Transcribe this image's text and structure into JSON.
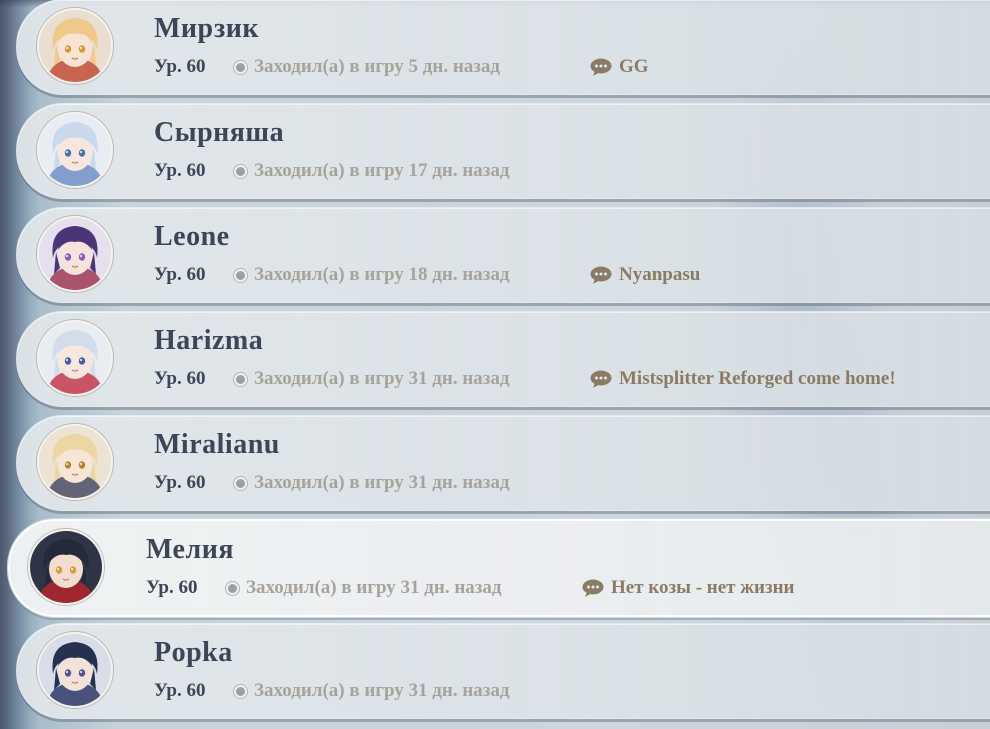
{
  "friends": [
    {
      "name": "Мирзик",
      "level": "Ур. 60",
      "last_login": "Заходил(а) в игру 5 дн. назад",
      "signature": "GG",
      "avatar_icon": "character-avatar-blonde",
      "avatar_palette": {
        "hair": "#f0c98a",
        "skin": "#f7e3d3",
        "eyes": "#d39a3a",
        "accent": "#c24f3a",
        "bg": "#e9ded0"
      }
    },
    {
      "name": "Сырняша",
      "level": "Ур. 60",
      "last_login": "Заходил(а) в игру 17 дн. назад",
      "signature": "",
      "avatar_icon": "character-avatar-silver",
      "avatar_palette": {
        "hair": "#c9d8ea",
        "skin": "#f7e7de",
        "eyes": "#4a74a8",
        "accent": "#6f8fc8",
        "bg": "#e7edf3"
      }
    },
    {
      "name": "Leone",
      "level": "Ур. 60",
      "last_login": "Заходил(а) в игру 18 дн. назад",
      "signature": "Nyanpasu",
      "avatar_icon": "character-avatar-purple",
      "avatar_palette": {
        "hair": "#4b3578",
        "skin": "#f6e3dd",
        "eyes": "#8a5fc0",
        "accent": "#a03a56",
        "bg": "#e6e0ee"
      }
    },
    {
      "name": "Harizma",
      "level": "Ур. 60",
      "last_login": "Заходил(а) в игру 31 дн. назад",
      "signature": "Mistsplitter Reforged come home!",
      "avatar_icon": "character-avatar-silver",
      "avatar_palette": {
        "hair": "#d2dcea",
        "skin": "#f7e7de",
        "eyes": "#4a5ea8",
        "accent": "#c2384c",
        "bg": "#e9edf2"
      }
    },
    {
      "name": "Miralianu",
      "level": "Ур. 60",
      "last_login": "Заходил(а) в игру 31 дн. назад",
      "signature": "",
      "avatar_icon": "character-avatar-blonde",
      "avatar_palette": {
        "hair": "#ead7a3",
        "skin": "#f7e5d6",
        "eyes": "#b8862e",
        "accent": "#4b4f66",
        "bg": "#ece3d3"
      }
    },
    {
      "name": "Мелия",
      "level": "Ур. 60",
      "last_login": "Заходил(а) в игру 31 дн. назад",
      "signature": "Нет козы - нет жизни",
      "avatar_icon": "character-avatar-dark",
      "avatar_palette": {
        "hair": "#252a3a",
        "skin": "#f2ddd0",
        "eyes": "#d0a03c",
        "accent": "#b3262e",
        "bg": "#2f3446"
      }
    },
    {
      "name": "Popka",
      "level": "Ур. 60",
      "last_login": "Заходил(а) в игру 31 дн. назад",
      "signature": "",
      "avatar_icon": "character-avatar-dark",
      "avatar_palette": {
        "hair": "#263150",
        "skin": "#f3e2d8",
        "eyes": "#5b4f9a",
        "accent": "#2e3a66",
        "bg": "#d9dde8"
      }
    }
  ],
  "selected_index": 5,
  "colors": {
    "name_text": "#3e4558",
    "meta_text": "#a7a39c",
    "signature_text": "#8b7b64",
    "chat_icon": "#8b7b64",
    "status_dot": "#9aa0a7"
  },
  "icons": {
    "status": "offline-status-dot-icon",
    "signature": "chat-bubble-icon"
  }
}
